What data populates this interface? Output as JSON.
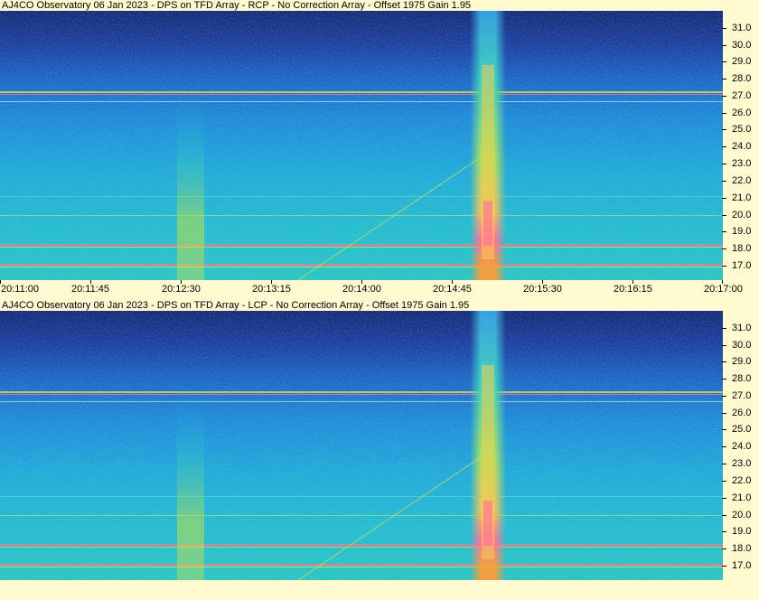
{
  "panels": [
    {
      "title": "AJ4CO Observatory 06 Jan 2023 - DPS on TFD Array  - RCP  -  No Correction Array  -  Offset 1975  Gain 1.95",
      "freq_ticks": [
        "31.0",
        "30.0",
        "29.0",
        "28.0",
        "27.0",
        "26.0",
        "25.0",
        "24.0",
        "23.0",
        "22.0",
        "21.0",
        "20.0",
        "19.0",
        "18.0",
        "17.0"
      ]
    },
    {
      "title": "AJ4CO Observatory 06 Jan 2023 - DPS on TFD Array  - LCP  -  No Correction Array  -  Offset 1975  Gain 1.95",
      "freq_ticks": [
        "31.0",
        "30.0",
        "29.0",
        "28.0",
        "27.0",
        "26.0",
        "25.0",
        "24.0",
        "23.0",
        "22.0",
        "21.0",
        "20.0",
        "19.0",
        "18.0",
        "17.0"
      ]
    }
  ],
  "time_ticks": [
    "20:11:00",
    "20:11:45",
    "20:12:30",
    "20:13:15",
    "20:14:00",
    "20:14:45",
    "20:15:30",
    "20:16:15",
    "20:17:00"
  ],
  "colors": {
    "background": "#fffad0",
    "spectrum_high": "#1a2a8a",
    "spectrum_mid": "#1f7fd6",
    "spectrum_low": "#22c0c8",
    "burst_core": "#ff6aa0",
    "burst_edge": "#f0d040"
  }
}
